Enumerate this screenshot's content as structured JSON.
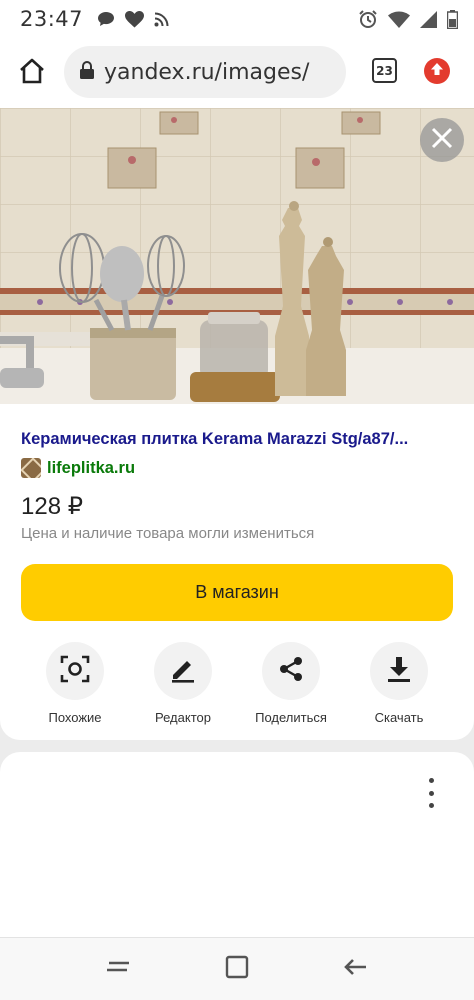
{
  "status_bar": {
    "time": "23:47",
    "left_icons": [
      "chat-bubble-icon",
      "heart-icon",
      "rss-icon"
    ],
    "right_icons": [
      "alarm-icon",
      "wifi-icon",
      "cellular-signal-icon",
      "battery-icon"
    ]
  },
  "browser": {
    "url": "yandex.ru/images/",
    "tab_count": "23",
    "icons": [
      "home-icon",
      "lock-icon",
      "tabs-icon",
      "update-arrow-icon"
    ]
  },
  "image_viewer": {
    "close_icon": "close-icon",
    "title": "Керамическая плитка Kerama Marazzi Stg/a87/...",
    "source": "lifeplitka.ru",
    "price": "128 ₽",
    "disclaimer": "Цена и наличие товара могли измениться",
    "shop_button": "В магазин",
    "actions": [
      {
        "label": "Похожие",
        "icon": "similar-search-icon"
      },
      {
        "label": "Редактор",
        "icon": "edit-pencil-icon"
      },
      {
        "label": "Поделиться",
        "icon": "share-icon"
      },
      {
        "label": "Скачать",
        "icon": "download-icon"
      }
    ]
  },
  "lower_card": {
    "menu_icon": "more-vertical-icon"
  },
  "nav_bar": {
    "icons": [
      "recent-apps-icon",
      "home-square-icon",
      "back-arrow-icon"
    ]
  },
  "colors": {
    "title": "#1a1a8c",
    "source": "#0a7a0a",
    "shop_button": "#ffcc00",
    "update_badge": "#e33b2e"
  }
}
